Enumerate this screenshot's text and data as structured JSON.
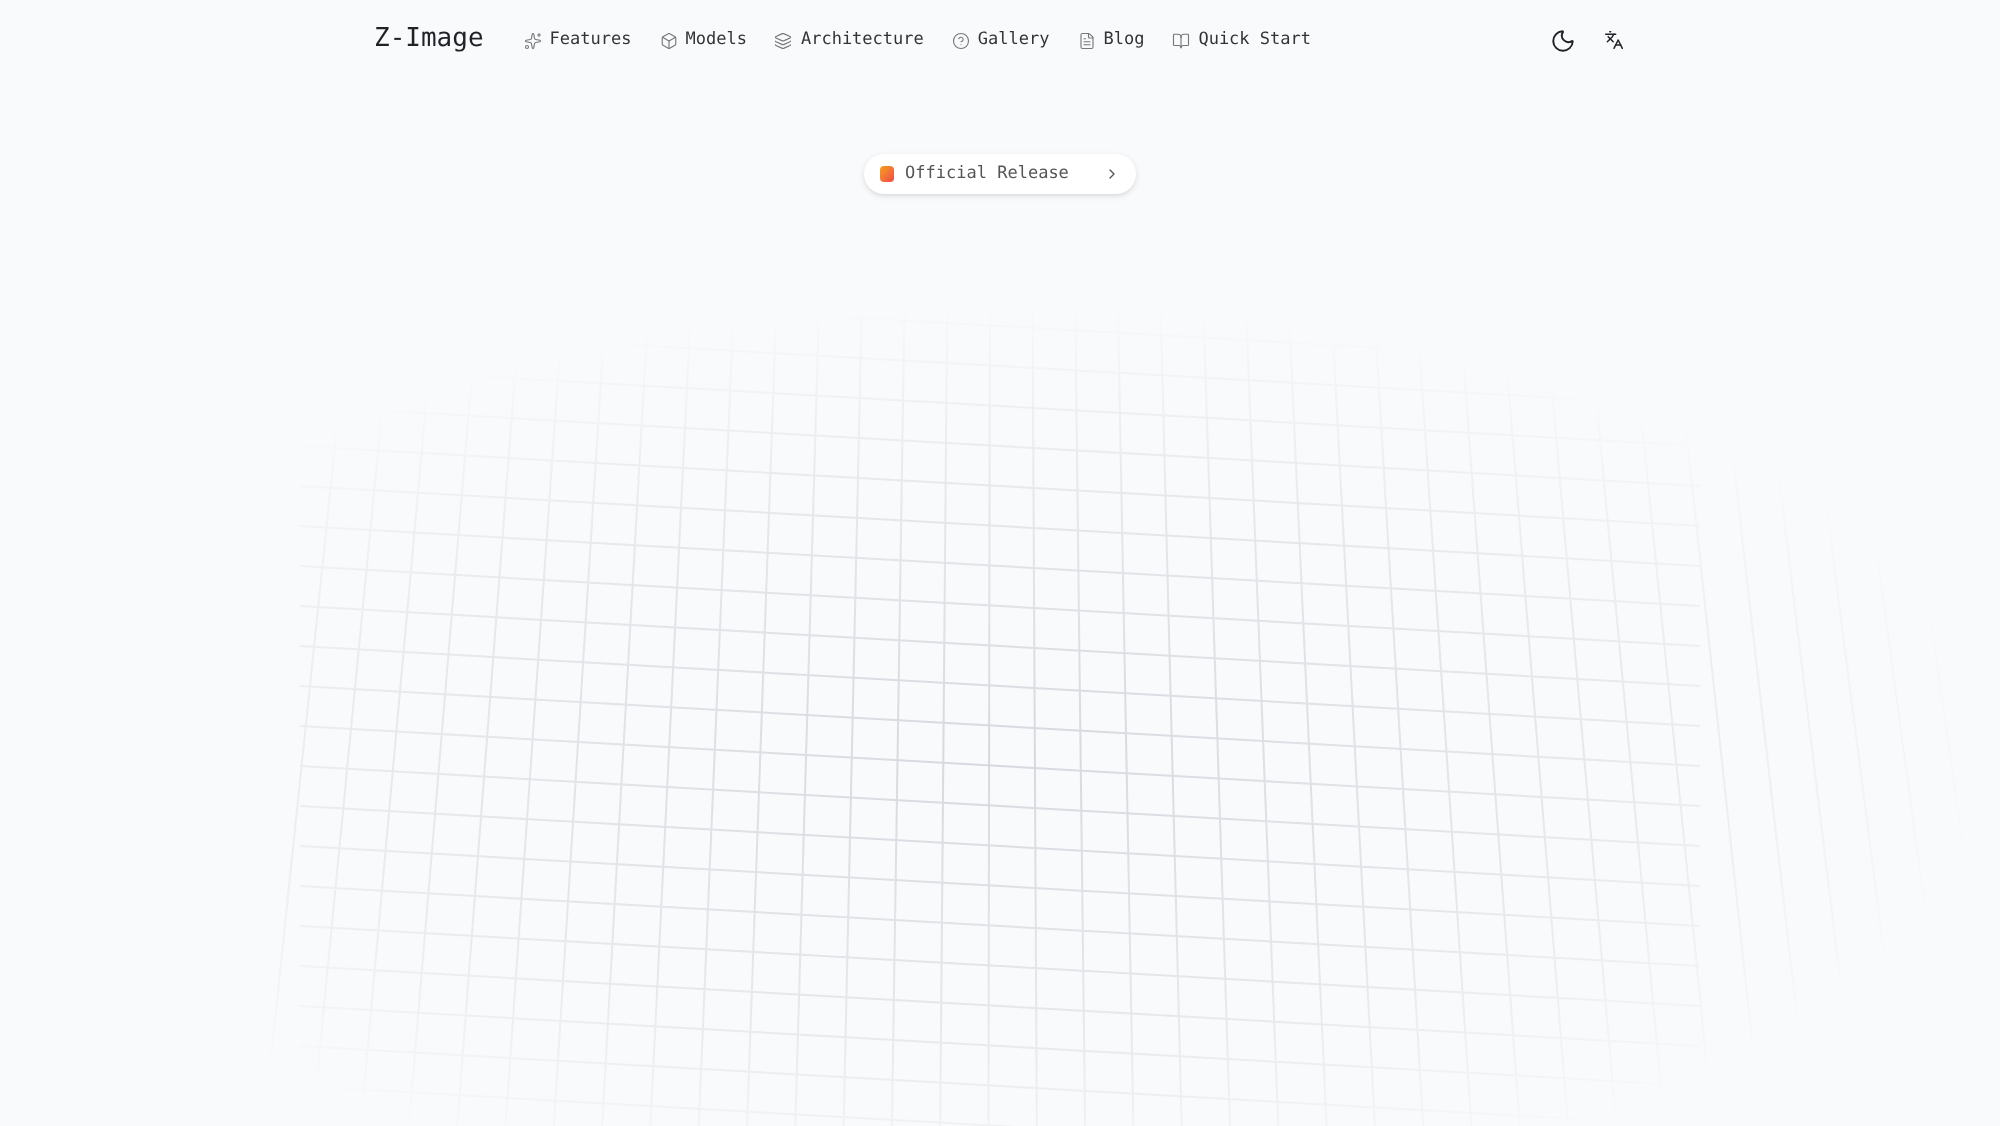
{
  "logo": "Z-Image",
  "nav": [
    {
      "label": "Features"
    },
    {
      "label": "Models"
    },
    {
      "label": "Architecture"
    },
    {
      "label": "Gallery"
    },
    {
      "label": "Blog"
    },
    {
      "label": "Quick Start"
    }
  ],
  "badge": {
    "label": "Official Release"
  }
}
